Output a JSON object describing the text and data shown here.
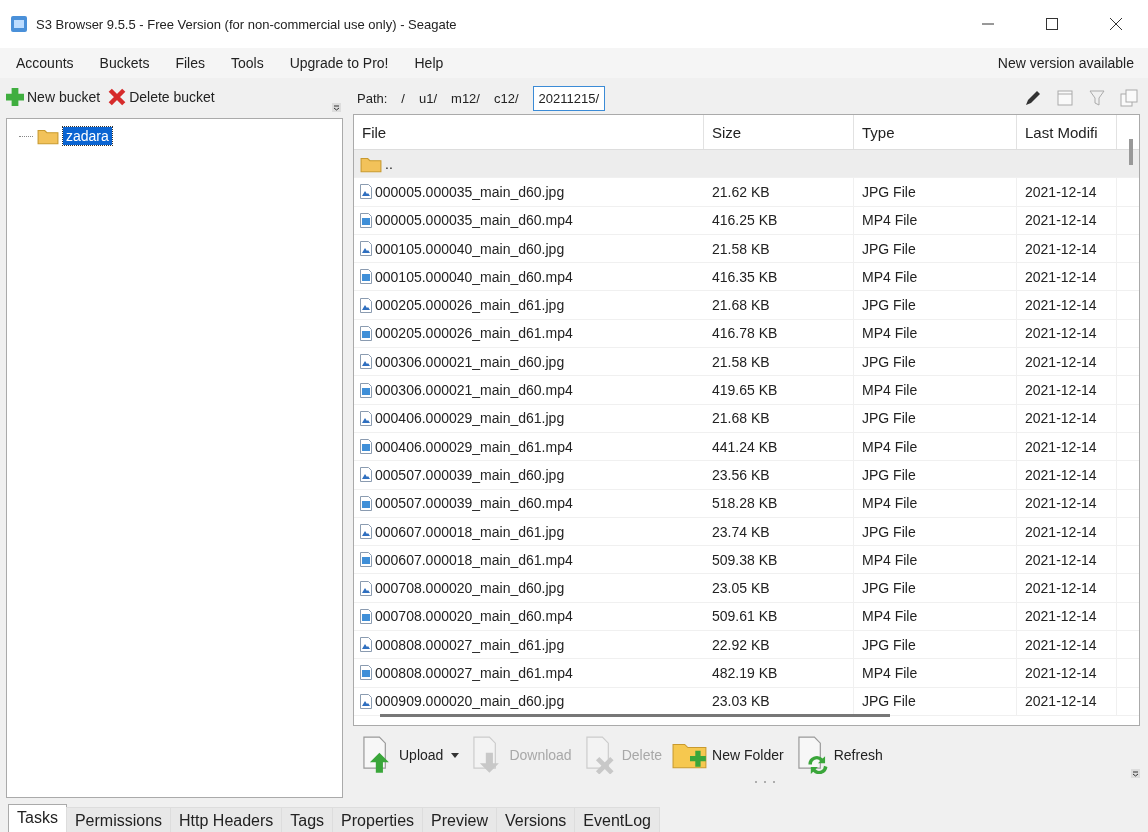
{
  "window": {
    "title": "S3 Browser 9.5.5 - Free Version (for non-commercial use only) - Seagate"
  },
  "menu": [
    {
      "label": "Accounts"
    },
    {
      "label": "Buckets"
    },
    {
      "label": "Files"
    },
    {
      "label": "Tools"
    },
    {
      "label": "Upgrade to Pro!"
    },
    {
      "label": "Help"
    }
  ],
  "notice": "New version available",
  "bucket_toolbar": [
    {
      "kind": "add",
      "label": "New bucket"
    },
    {
      "kind": "delete",
      "label": "Delete bucket"
    }
  ],
  "tree": [
    {
      "label": "zadara",
      "selected": true
    }
  ],
  "path": {
    "label": "Path:",
    "segments": [
      "/",
      "u1/",
      "m12/",
      "c12/"
    ],
    "value": "20211215/"
  },
  "table": {
    "columns": [
      "File",
      "Size",
      "Type",
      "Last Modifi"
    ],
    "rows": [
      {
        "kind": "parent",
        "file": ".."
      },
      {
        "kind": "jpg",
        "file": "000005.000035_main_d60.jpg",
        "size": "21.62 KB",
        "type": "JPG File",
        "modified": "2021-12-14"
      },
      {
        "kind": "mp4",
        "file": "000005.000035_main_d60.mp4",
        "size": "416.25 KB",
        "type": "MP4 File",
        "modified": "2021-12-14"
      },
      {
        "kind": "jpg",
        "file": "000105.000040_main_d60.jpg",
        "size": "21.58 KB",
        "type": "JPG File",
        "modified": "2021-12-14"
      },
      {
        "kind": "mp4",
        "file": "000105.000040_main_d60.mp4",
        "size": "416.35 KB",
        "type": "MP4 File",
        "modified": "2021-12-14"
      },
      {
        "kind": "jpg",
        "file": "000205.000026_main_d61.jpg",
        "size": "21.68 KB",
        "type": "JPG File",
        "modified": "2021-12-14"
      },
      {
        "kind": "mp4",
        "file": "000205.000026_main_d61.mp4",
        "size": "416.78 KB",
        "type": "MP4 File",
        "modified": "2021-12-14"
      },
      {
        "kind": "jpg",
        "file": "000306.000021_main_d60.jpg",
        "size": "21.58 KB",
        "type": "JPG File",
        "modified": "2021-12-14"
      },
      {
        "kind": "mp4",
        "file": "000306.000021_main_d60.mp4",
        "size": "419.65 KB",
        "type": "MP4 File",
        "modified": "2021-12-14"
      },
      {
        "kind": "jpg",
        "file": "000406.000029_main_d61.jpg",
        "size": "21.68 KB",
        "type": "JPG File",
        "modified": "2021-12-14"
      },
      {
        "kind": "mp4",
        "file": "000406.000029_main_d61.mp4",
        "size": "441.24 KB",
        "type": "MP4 File",
        "modified": "2021-12-14"
      },
      {
        "kind": "jpg",
        "file": "000507.000039_main_d60.jpg",
        "size": "23.56 KB",
        "type": "JPG File",
        "modified": "2021-12-14"
      },
      {
        "kind": "mp4",
        "file": "000507.000039_main_d60.mp4",
        "size": "518.28 KB",
        "type": "MP4 File",
        "modified": "2021-12-14"
      },
      {
        "kind": "jpg",
        "file": "000607.000018_main_d61.jpg",
        "size": "23.74 KB",
        "type": "JPG File",
        "modified": "2021-12-14"
      },
      {
        "kind": "mp4",
        "file": "000607.000018_main_d61.mp4",
        "size": "509.38 KB",
        "type": "MP4 File",
        "modified": "2021-12-14"
      },
      {
        "kind": "jpg",
        "file": "000708.000020_main_d60.jpg",
        "size": "23.05 KB",
        "type": "JPG File",
        "modified": "2021-12-14"
      },
      {
        "kind": "mp4",
        "file": "000708.000020_main_d60.mp4",
        "size": "509.61 KB",
        "type": "MP4 File",
        "modified": "2021-12-14"
      },
      {
        "kind": "jpg",
        "file": "000808.000027_main_d61.jpg",
        "size": "22.92 KB",
        "type": "JPG File",
        "modified": "2021-12-14"
      },
      {
        "kind": "mp4",
        "file": "000808.000027_main_d61.mp4",
        "size": "482.19 KB",
        "type": "MP4 File",
        "modified": "2021-12-14"
      },
      {
        "kind": "jpg",
        "file": "000909.000020_main_d60.jpg",
        "size": "23.03 KB",
        "type": "JPG File",
        "modified": "2021-12-14"
      }
    ]
  },
  "file_toolbar": [
    {
      "kind": "upload",
      "label": "Upload",
      "disabled": false,
      "dropdown": true
    },
    {
      "kind": "download",
      "label": "Download",
      "disabled": true,
      "dropdown": false
    },
    {
      "kind": "delete",
      "label": "Delete",
      "disabled": true,
      "dropdown": false
    },
    {
      "kind": "new-folder",
      "label": "New Folder",
      "disabled": false,
      "dropdown": false
    },
    {
      "kind": "refresh",
      "label": "Refresh",
      "disabled": false,
      "dropdown": false
    }
  ],
  "tabs": [
    {
      "label": "Tasks",
      "selected": true
    },
    {
      "label": "Permissions",
      "selected": false
    },
    {
      "label": "Http Headers",
      "selected": false
    },
    {
      "label": "Tags",
      "selected": false
    },
    {
      "label": "Properties",
      "selected": false
    },
    {
      "label": "Preview",
      "selected": false
    },
    {
      "label": "Versions",
      "selected": false
    },
    {
      "label": "EventLog",
      "selected": false
    }
  ]
}
